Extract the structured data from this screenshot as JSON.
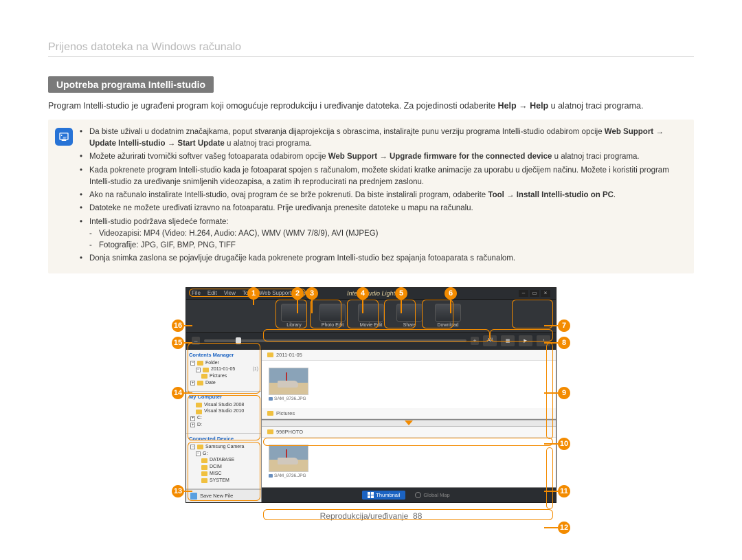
{
  "breadcrumb": "Prijenos datoteka na Windows računalo",
  "section_heading": "Upotreba programa Intelli-studio",
  "intro_html": "Program Intelli-studio je ugrađeni program koji omogućuje reprodukciju i uređivanje datoteka. Za pojedinosti odaberite <b>Help</b> → <b>Help</b> u alatnoj traci programa.",
  "notes": [
    "Da biste uživali u dodatnim značajkama, poput stvaranja dijaprojekcija s obrascima, instalirajte punu verziju programa Intelli-studio odabirom opcije <b>Web Support</b> → <b>Update Intelli-studio</b> → <b>Start Update</b> u alatnoj traci programa.",
    "Možete ažurirati tvornički softver vašeg fotoaparata odabirom opcije <b>Web Support</b> → <b>Upgrade firmware for the connected device</b> u alatnoj traci programa.",
    "Kada pokrenete program Intelli-studio kada je fotoaparat spojen s računalom, možete skidati kratke animacije za uporabu u dječijem načinu. Možete i koristiti program Intelli-studio za uređivanje snimljenih videozapisa, a zatim ih reproducirati na prednjem zaslonu.",
    "Ako na računalo instalirate Intelli-studio, ovaj program će se brže pokrenuti. Da biste instalirali program, odaberite <b>Tool</b> → <b>Install Intelli-studio on PC</b>.",
    "Datoteke ne možete uređivati izravno na fotoaparatu. Prije uređivanja prenesite datoteke u mapu na računalu.",
    "Intelli-studio podržava sljedeće formate:"
  ],
  "formats": [
    "Videozapisi: MP4 (Video: H.264, Audio: AAC), WMV (WMV 7/8/9), AVI (MJPEG)",
    "Fotografije: JPG, GIF, BMP, PNG, TIFF"
  ],
  "note_last": "Donja snimka zaslona se pojavljuje drugačije kada pokrenete program Intelli-studio bez spajanja fotoaparata s računalom.",
  "app": {
    "title": "Intelli-studio Light",
    "menus": [
      "File",
      "Edit",
      "View",
      "Tool",
      "Web Support",
      "Help"
    ],
    "toolbar": [
      {
        "label": "Library"
      },
      {
        "label": "Photo Edit"
      },
      {
        "label": "Movie Edit"
      },
      {
        "label": "Share"
      },
      {
        "label": "Download"
      }
    ],
    "filter_all": "All",
    "sidebar": {
      "contents_title": "Contents Manager",
      "folder_root": "Folder",
      "date_folder": "2011-01-05",
      "date_folder_count": "(1)",
      "pictures": "Pictures",
      "date_node": "Date",
      "mycomp_title": "My Computer",
      "vs2008": "Visual Studio 2008",
      "vs2010": "Visual Studio 2010",
      "c_drive": "C:",
      "d_drive": "D:",
      "device_title": "Connected Device",
      "camera": "Samsung Camera",
      "g_drive": "G:",
      "database": "DATABASE",
      "dcim": "DCIM",
      "misc": "MISC",
      "system": "SYSTEM",
      "save": "Save New File"
    },
    "sections": {
      "date": "2011-01-05",
      "pictures": "Pictures",
      "device_folder": "998PHOTO"
    },
    "thumb_name": "SAM_8736.JPG",
    "bottom": {
      "thumbnail": "Thumbnail",
      "globalmap": "Global Map"
    }
  },
  "footer": {
    "label": "Reprodukcija/uređivanje",
    "page": "88"
  }
}
